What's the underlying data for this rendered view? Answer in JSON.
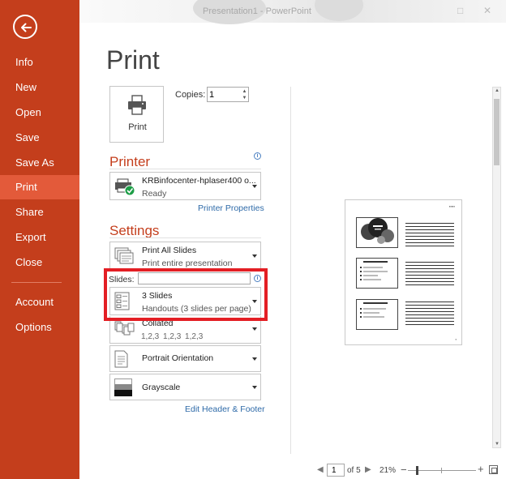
{
  "window": {
    "title": "Presentation1 - PowerPoint"
  },
  "sidebar": {
    "items": [
      {
        "label": "Info"
      },
      {
        "label": "New"
      },
      {
        "label": "Open"
      },
      {
        "label": "Save"
      },
      {
        "label": "Save As"
      },
      {
        "label": "Print"
      },
      {
        "label": "Share"
      },
      {
        "label": "Export"
      },
      {
        "label": "Close"
      },
      {
        "label": "Account"
      },
      {
        "label": "Options"
      }
    ],
    "active_item": "Print"
  },
  "page": {
    "heading": "Print",
    "print_button_label": "Print",
    "copies_label": "Copies:",
    "copies_value": "1"
  },
  "printer": {
    "heading": "Printer",
    "name": "KRBinfocenter-hplaser400 o...",
    "status": "Ready",
    "properties_link": "Printer Properties"
  },
  "settings": {
    "heading": "Settings",
    "slides_range": {
      "main": "Print All Slides",
      "sub": "Print entire presentation"
    },
    "slides_label": "Slides:",
    "slides_value": "",
    "layout": {
      "main": "3 Slides",
      "sub": "Handouts (3 slides per page)"
    },
    "collation": {
      "main": "Collated",
      "sub": "1,2,3   1,2,3   1,2,3"
    },
    "orientation": {
      "main": "Portrait Orientation"
    },
    "color": {
      "main": "Grayscale"
    },
    "header_footer_link": "Edit Header & Footer"
  },
  "preview_nav": {
    "current_page": "1",
    "of_label": "of 5",
    "zoom": "21%"
  },
  "colors": {
    "accent": "#c43e1c",
    "sidebar_active": "#e35a3a",
    "highlight_frame": "#e31e24",
    "link": "#2e6aa8"
  }
}
